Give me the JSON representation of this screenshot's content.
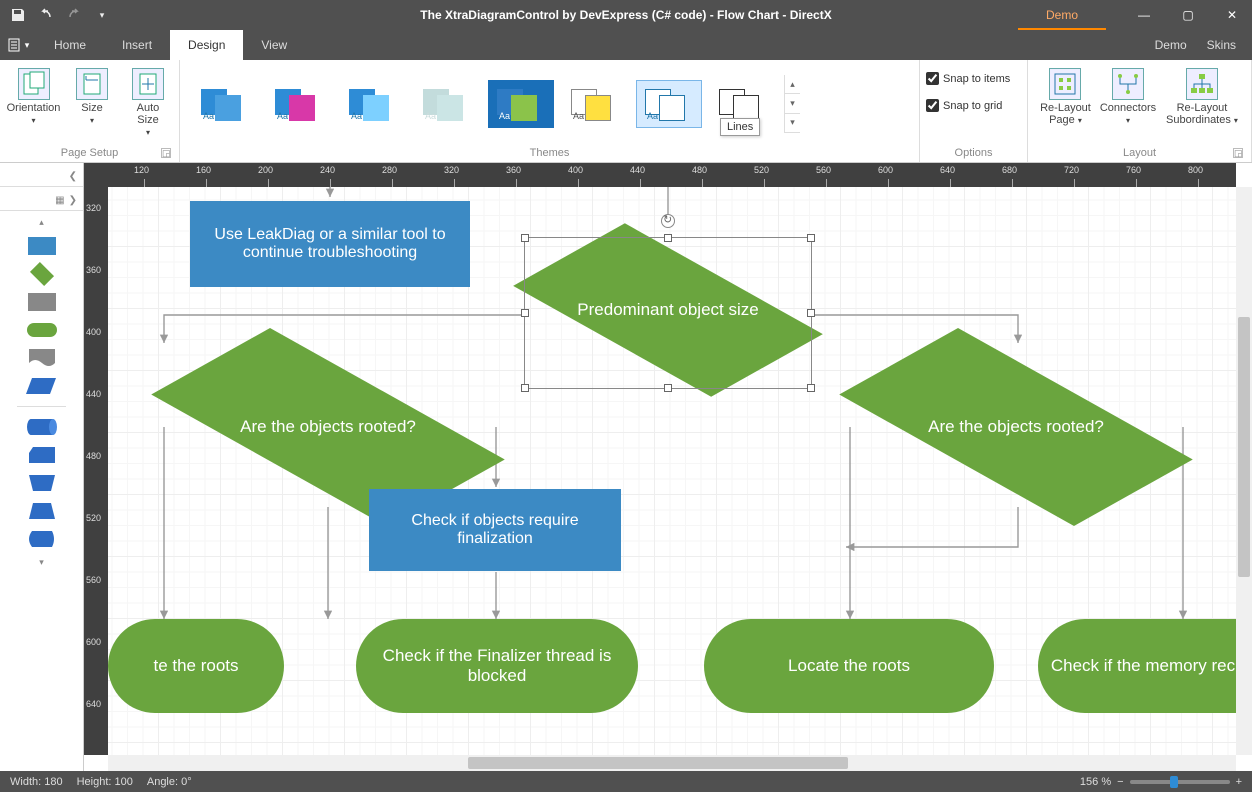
{
  "title": "The XtraDiagramControl by DevExpress (C# code) - Flow Chart - DirectX",
  "topRight": {
    "demo": "Demo"
  },
  "menuTabs": {
    "home": "Home",
    "insert": "Insert",
    "design": "Design",
    "view": "View",
    "demoTab": "Demo",
    "skins": "Skins"
  },
  "ribbon": {
    "pageSetup": {
      "label": "Page Setup",
      "orientation": "Orientation",
      "size": "Size",
      "autoSize": "Auto Size"
    },
    "themes": {
      "label": "Themes",
      "tooltip": "Lines"
    },
    "options": {
      "label": "Options",
      "snapItems": "Snap to items",
      "snapGrid": "Snap to grid"
    },
    "layout": {
      "label": "Layout",
      "relayoutPage": "Re-Layout Page",
      "connectors": "Connectors",
      "relayoutSub": "Re-Layout Subordinates"
    }
  },
  "rulerH": [
    "120",
    "160",
    "200",
    "240",
    "280",
    "320",
    "360",
    "400",
    "440",
    "480",
    "520",
    "560",
    "600",
    "640",
    "680",
    "720",
    "760",
    "800"
  ],
  "rulerV": [
    "320",
    "360",
    "400",
    "440",
    "480",
    "520",
    "560",
    "600",
    "640"
  ],
  "shapes": {
    "leakdiag": "Use LeakDiag or a similar tool to continue troubleshooting",
    "predominant": "Predominant object size",
    "rooted1": "Are the objects rooted?",
    "rooted2": "Are the objects rooted?",
    "finalize": "Check if objects require finalization",
    "finalizer": "Check if the Finalizer thread is blocked",
    "locate1": "te the roots",
    "locate2": "Locate the roots",
    "reclaimed": "Check if the memory reclaimed"
  },
  "status": {
    "width": "Width:  180",
    "height": "Height:  100",
    "angle": "Angle:  0°",
    "zoom": "156 %"
  }
}
